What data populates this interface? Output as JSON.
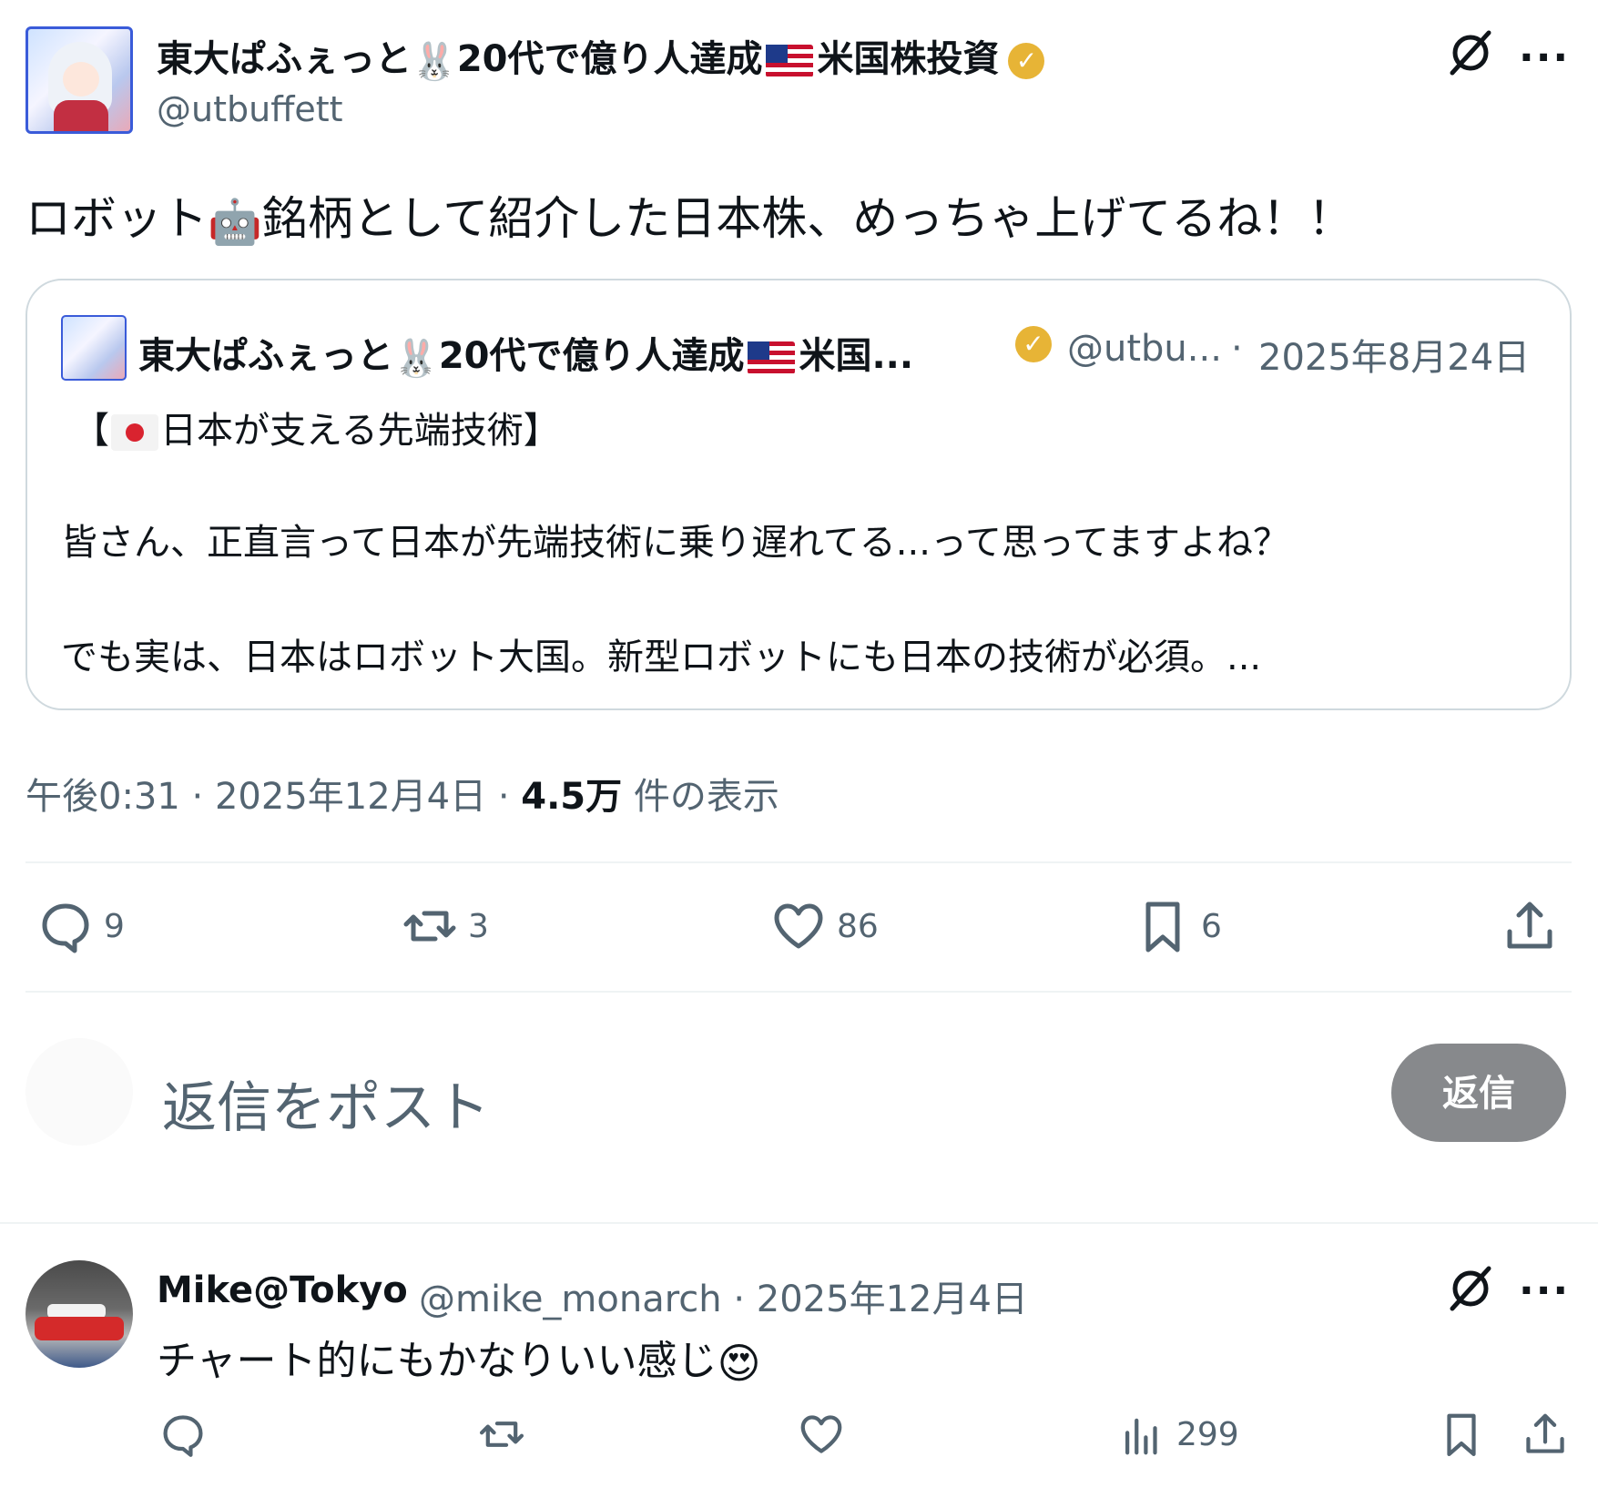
{
  "post": {
    "author_name_part1": "東大ぱふぇっと",
    "author_name_part2": "20代で億り人達成",
    "author_name_part3": "米国株投資",
    "handle": "@utbuffett",
    "text_before_emoji": "ロボット",
    "text_after_emoji": "銘柄として紹介した日本株、めっちゃ上げてるね！！",
    "meta_time": "午後0:31 · 2025年12月4日 · ",
    "meta_views": "4.5万",
    "meta_views_label": " 件の表示"
  },
  "quote": {
    "author_name_part1": "東大ぱふぇっと",
    "author_name_part2": "20代で億り人達成",
    "author_name_part3": "米国...",
    "handle": "@utbu...",
    "separator": "·",
    "date": "2025年8月24日",
    "line1_open": "【",
    "line1_text": "日本が支える先端技術】",
    "line2": "皆さん、正直言って日本が先端技術に乗り遅れてる...って思ってますよね？",
    "line3": "でも実は、日本はロボット大国。新型ロボットにも日本の技術が必須。..."
  },
  "actions": {
    "replies": "9",
    "reposts": "3",
    "likes": "86",
    "bookmarks": "6"
  },
  "reply_box": {
    "placeholder": "返信をポスト",
    "button_label": "返信"
  },
  "reply": {
    "author_name": "Mike@Tokyo",
    "handle_date": "@mike_monarch · 2025年12月4日",
    "text": "チャート的にもかなりいい感じ",
    "views": "299"
  },
  "icons": {
    "verified": "verified-badge-icon",
    "grok": "grok-icon",
    "more": "more-icon",
    "reply": "reply-icon",
    "repost": "repost-icon",
    "like": "like-icon",
    "bookmark": "bookmark-icon",
    "share": "share-icon",
    "views": "views-icon"
  },
  "colors": {
    "verified_gold": "#e7b436",
    "secondary_text": "#536471",
    "reply_button_bg": "#87898c"
  }
}
